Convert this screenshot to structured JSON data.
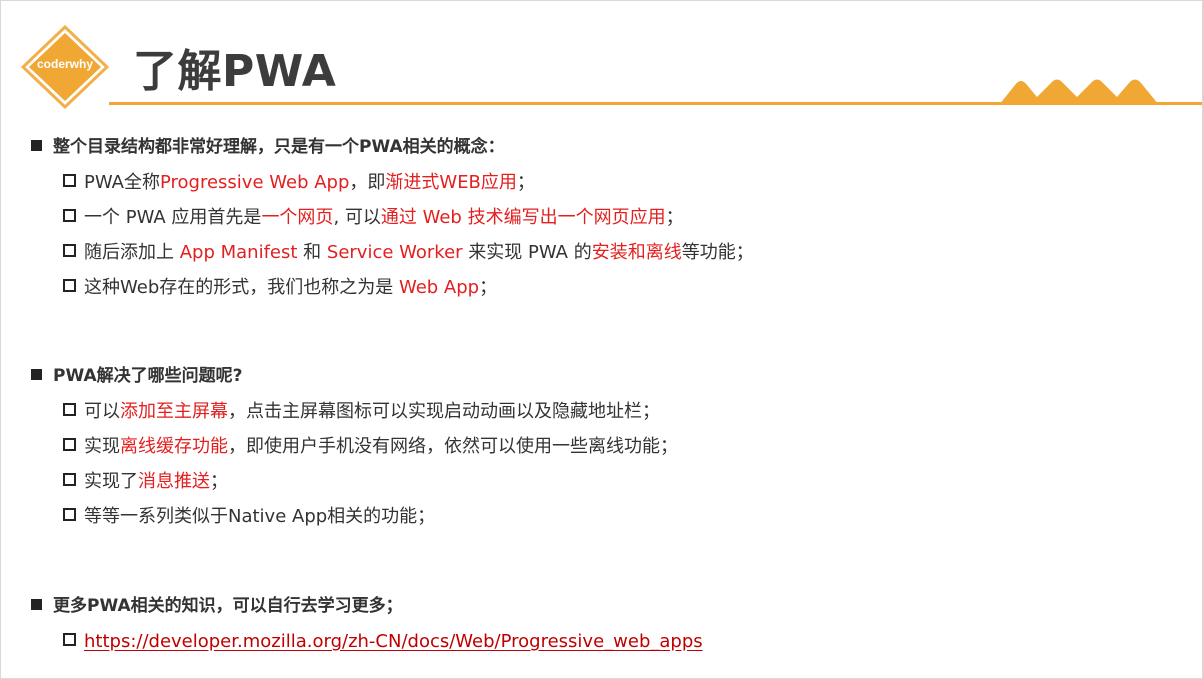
{
  "header": {
    "logo_text": "coderwhy",
    "title": "了解PWA",
    "colors": {
      "accent": "#f0a734",
      "highlight": "#e31f1f",
      "link": "#c00000"
    }
  },
  "sections": [
    {
      "title": "整个目录结构都非常好理解，只是有一个PWA相关的概念：",
      "items": [
        {
          "p1": "PWA全称",
          "h1": "Progressive Web App",
          "p2": "，即",
          "h2": "渐进式WEB应用",
          "p3": "；"
        },
        {
          "p1": "一个 PWA 应用首先是",
          "h1": "一个网页",
          "p2": ", 可以",
          "h2": "通过 Web 技术编写出一个网页应用",
          "p3": "；"
        },
        {
          "p1": "随后添加上 ",
          "h1": "App Manifest",
          "p2": " 和 ",
          "h2": "Service Worker",
          "p3": " 来实现 PWA 的",
          "h3": "安装和离线",
          "p4": "等功能；"
        },
        {
          "p1": "这种Web存在的形式，我们也称之为是 ",
          "h1": "Web App",
          "p2": "；"
        }
      ]
    },
    {
      "title": "PWA解决了哪些问题呢?",
      "items": [
        {
          "p1": "可以",
          "h1": "添加至主屏幕",
          "p2": "，点击主屏幕图标可以实现启动动画以及隐藏地址栏；"
        },
        {
          "p1": "实现",
          "h1": "离线缓存功能",
          "p2": "，即使用户手机没有网络，依然可以使用一些离线功能；"
        },
        {
          "p1": "实现了",
          "h1": "消息推送",
          "p2": "；"
        },
        {
          "p1": "等等一系列类似于Native App相关的功能；"
        }
      ]
    },
    {
      "title": "更多PWA相关的知识，可以自行去学习更多；",
      "items": [
        {
          "link": "https://developer.mozilla.org/zh-CN/docs/Web/Progressive_web_apps"
        }
      ]
    }
  ]
}
